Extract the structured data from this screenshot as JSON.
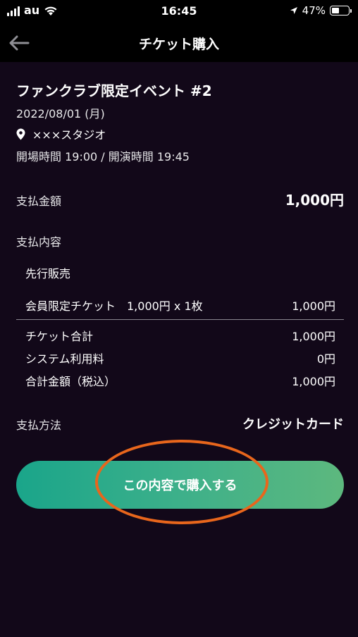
{
  "status_bar": {
    "carrier": "au",
    "time": "16:45",
    "battery_percent": "47%",
    "battery_level": 0.47,
    "icons": [
      "signal-icon",
      "wifi-icon",
      "location-arrow-icon",
      "battery-icon"
    ]
  },
  "nav": {
    "title": "チケット購入",
    "back_icon": "arrow-left-icon"
  },
  "event": {
    "title": "ファンクラブ限定イベント #2",
    "date": "2022/08/01 (月)",
    "venue": "×××スタジオ",
    "venue_icon": "map-pin-icon",
    "time": "開場時間 19:00 / 開演時間 19:45"
  },
  "payment": {
    "amount_label": "支払金額",
    "amount_value": "1,000円",
    "detail_label": "支払内容",
    "presale_label": "先行販売",
    "item": {
      "name": "会員限定チケット　1,000円 x 1枚",
      "price": "1,000円"
    },
    "summary": [
      {
        "label": "チケット合計",
        "value": "1,000円"
      },
      {
        "label": "システム利用料",
        "value": "0円"
      },
      {
        "label": "合計金額（税込）",
        "value": "1,000円"
      }
    ],
    "method_label": "支払方法",
    "method_value": "クレジットカード"
  },
  "purchase_button": {
    "label": "この内容で購入する"
  },
  "colors": {
    "background": "#120819",
    "header": "#000000",
    "button_start": "#1aa58a",
    "button_end": "#5db87e",
    "highlight": "#e8661c"
  }
}
